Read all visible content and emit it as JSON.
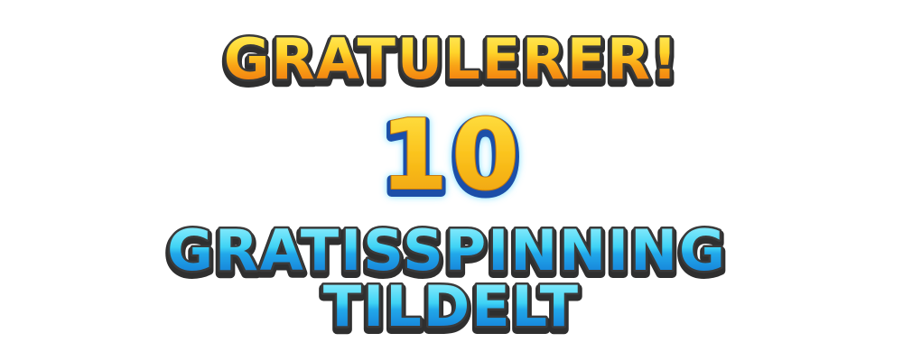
{
  "popup": {
    "heading": "GRATULERER!",
    "spin_count": "10",
    "reward_line1": "GRATISSPINNING",
    "reward_line2": "TILDELT"
  },
  "colors": {
    "heading_gradient_top": "#ffe83a",
    "heading_gradient_bottom": "#f07a10",
    "heading_outline": "#3a3a3a",
    "count_fill_top": "#ffd62a",
    "count_fill_bottom": "#f0a80c",
    "count_outline": "#1a4fa8",
    "count_glow": "#5ad8ff",
    "reward_gradient_top": "#7ff0ff",
    "reward_gradient_bottom": "#1178d8",
    "reward_outline": "#3a3a3a",
    "background": "#ffffff"
  }
}
